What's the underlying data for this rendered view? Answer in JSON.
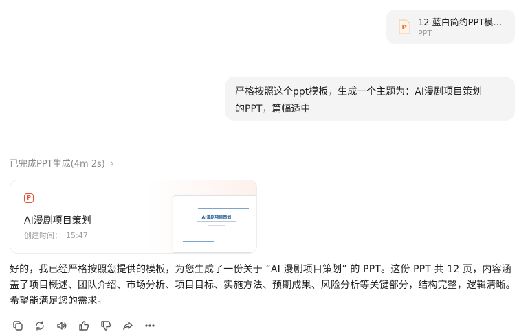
{
  "attachment": {
    "name": "12 蓝白简约PPT模…",
    "type": "PPT",
    "icon": "ppt-file-icon",
    "icon_color": "#e8742c"
  },
  "user_message": {
    "line1": "严格按照这个ppt模板，生成一个主题为：AI漫剧项目策划",
    "line2": "的PPT，篇幅适中"
  },
  "status": {
    "label": "已完成PPT生成(4m 2s)",
    "chevron": "›"
  },
  "ppt_card": {
    "badge": "P",
    "title": "AI漫剧项目策划",
    "created_label": "创建时间：",
    "created_time": "15:47",
    "thumbnail_title": "AI漫剧项目策划",
    "accent_color": "#e2533f"
  },
  "reply": {
    "text": "好的，我已经严格按照您提供的模板，为您生成了一份关于 “AI 漫剧项目策划” 的 PPT。这份 PPT 共 12 页，内容涵盖了项目概述、团队介绍、市场分析、项目目标、实施方法、预期成果、风险分析等关键部分，结构完整，逻辑清晰。希望能满足您的需求。"
  },
  "actions": [
    "copy-icon",
    "regenerate-icon",
    "speaker-icon",
    "thumbs-up-icon",
    "thumbs-down-icon",
    "share-icon",
    "more-icon"
  ]
}
